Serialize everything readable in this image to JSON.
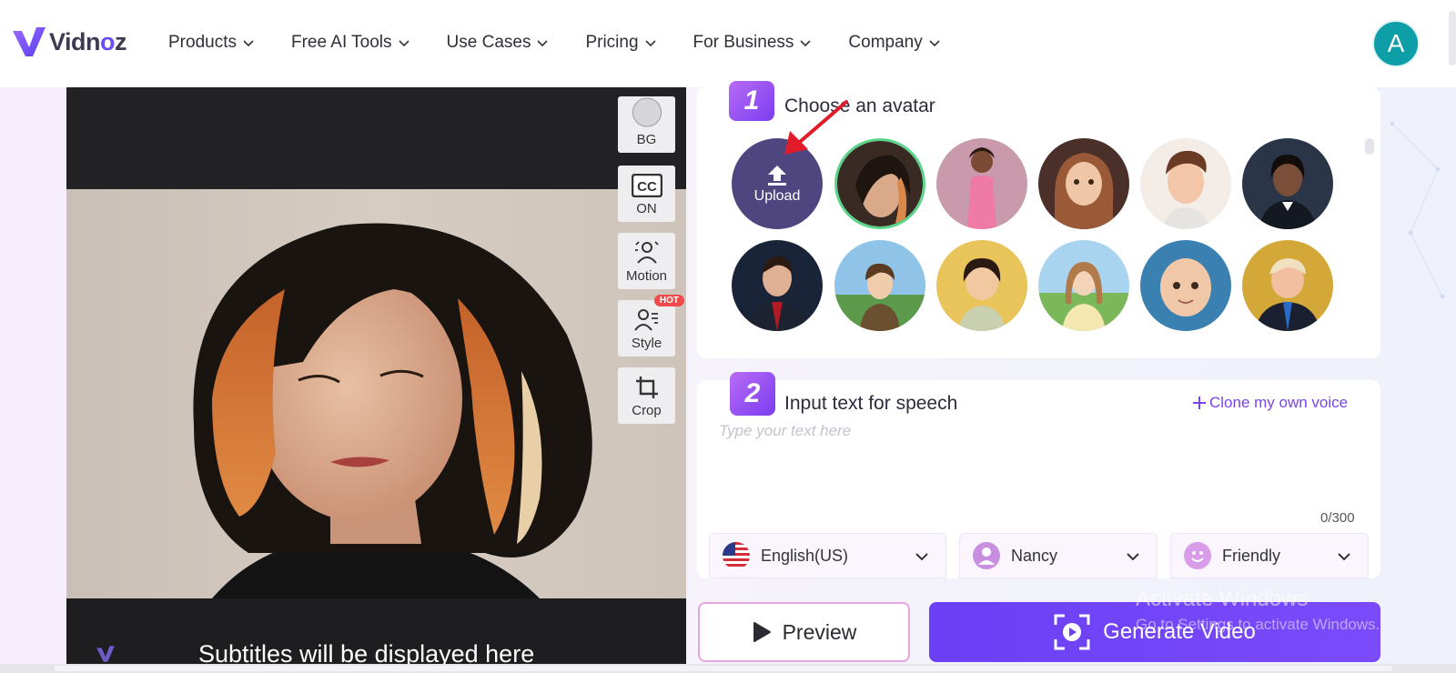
{
  "brand": {
    "name_prefix": "Vidn",
    "name_o": "o",
    "name_suffix": "z",
    "accent": "#6b4cf6"
  },
  "nav": {
    "items": [
      {
        "label": "Products"
      },
      {
        "label": "Free AI Tools"
      },
      {
        "label": "Use Cases"
      },
      {
        "label": "Pricing"
      },
      {
        "label": "For Business"
      },
      {
        "label": "Company"
      }
    ]
  },
  "user": {
    "initial": "A",
    "color": "#0e9ea8"
  },
  "preview": {
    "subtitle": "Subtitles will be displayed here",
    "tools": [
      {
        "label": "BG",
        "icon": "circle-icon"
      },
      {
        "label": "ON",
        "icon": "closed-caption-icon"
      },
      {
        "label": "Motion",
        "icon": "motion-person-icon"
      },
      {
        "label": "Style",
        "icon": "style-person-icon",
        "badge": "HOT"
      },
      {
        "label": "Crop",
        "icon": "crop-icon"
      }
    ]
  },
  "step1": {
    "number": "1",
    "title": "Choose an avatar",
    "upload_label": "Upload",
    "selected_index": 0,
    "avatar_count": 11
  },
  "step2": {
    "number": "2",
    "title": "Input text for speech",
    "clone_link": "Clone my own voice",
    "placeholder": "Type your text here",
    "char_count": "0/300",
    "language": "English(US)",
    "voice": "Nancy",
    "tone": "Friendly"
  },
  "actions": {
    "preview": "Preview",
    "generate": "Generate Video"
  },
  "watermark": {
    "line1": "Activate Windows",
    "line2": "Go to Settings to activate Windows."
  }
}
